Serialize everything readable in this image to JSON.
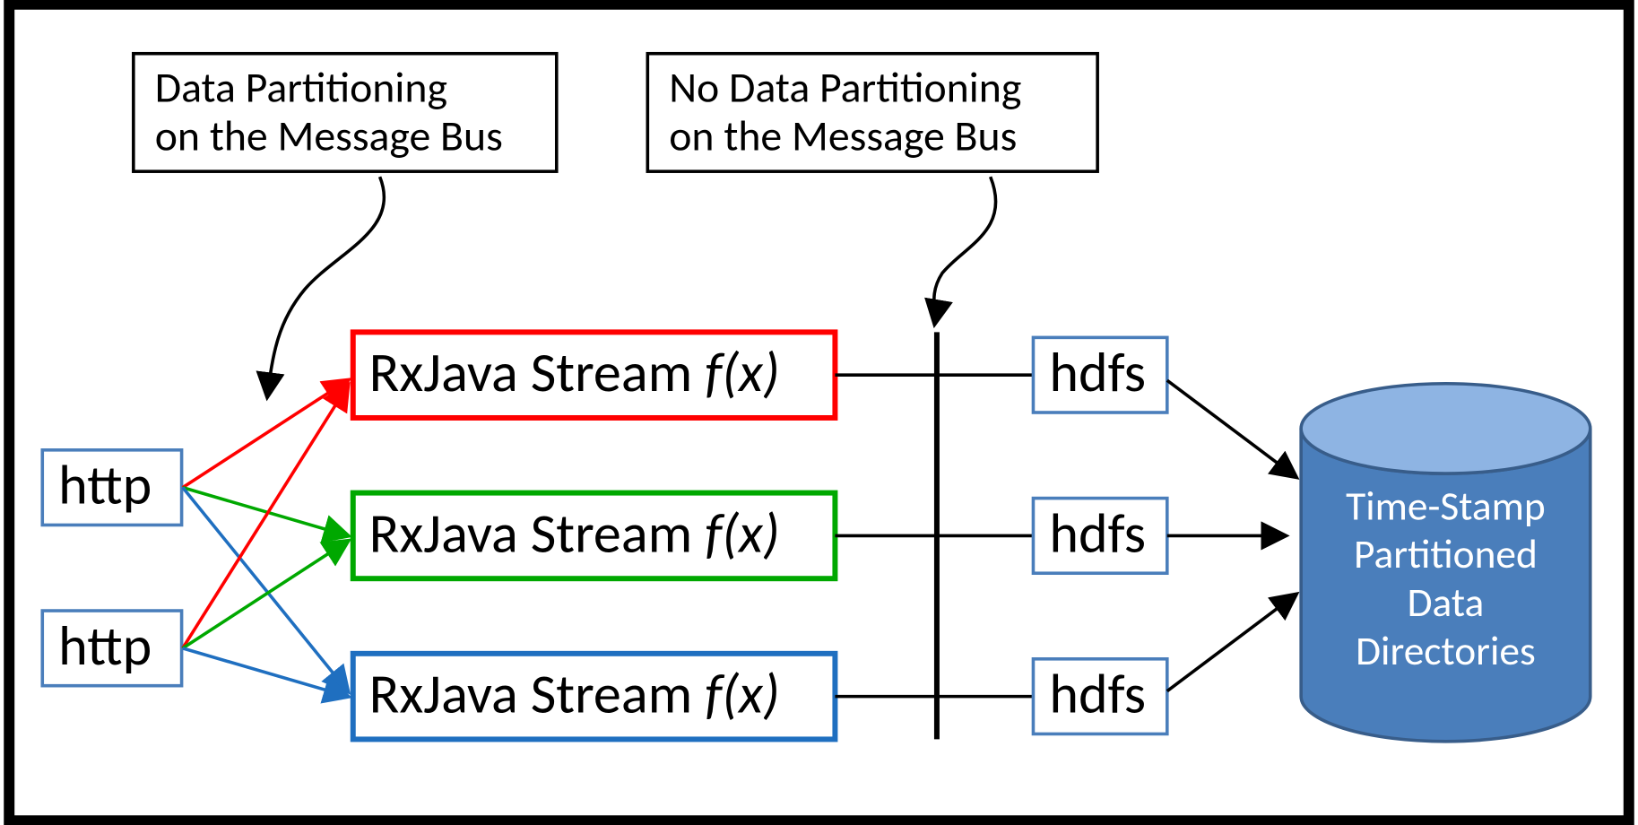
{
  "labels": {
    "left": {
      "line1": "Data Partitioning",
      "line2": "on the Message Bus"
    },
    "right": {
      "line1": "No Data Partitioning",
      "line2": "on the Message Bus"
    }
  },
  "http": {
    "top": "http",
    "bottom": "http"
  },
  "rxjava": {
    "row1": {
      "text": "RxJava Stream ",
      "fx": "f(x)"
    },
    "row2": {
      "text": "RxJava Stream ",
      "fx": "f(x)"
    },
    "row3": {
      "text": "RxJava Stream ",
      "fx": "f(x)"
    }
  },
  "hdfs": {
    "row1": "hdfs",
    "row2": "hdfs",
    "row3": "hdfs"
  },
  "cylinder": {
    "line1": "Time-Stamp",
    "line2": "Partitioned",
    "line3": "Data",
    "line4": "Directories"
  },
  "colors": {
    "red": "#ff0000",
    "green": "#00a800",
    "blue": "#1f6fc0",
    "steel": "#4a7ebb",
    "cylSide": "#4a7ebb",
    "cylTop": "#8eb4e3"
  }
}
